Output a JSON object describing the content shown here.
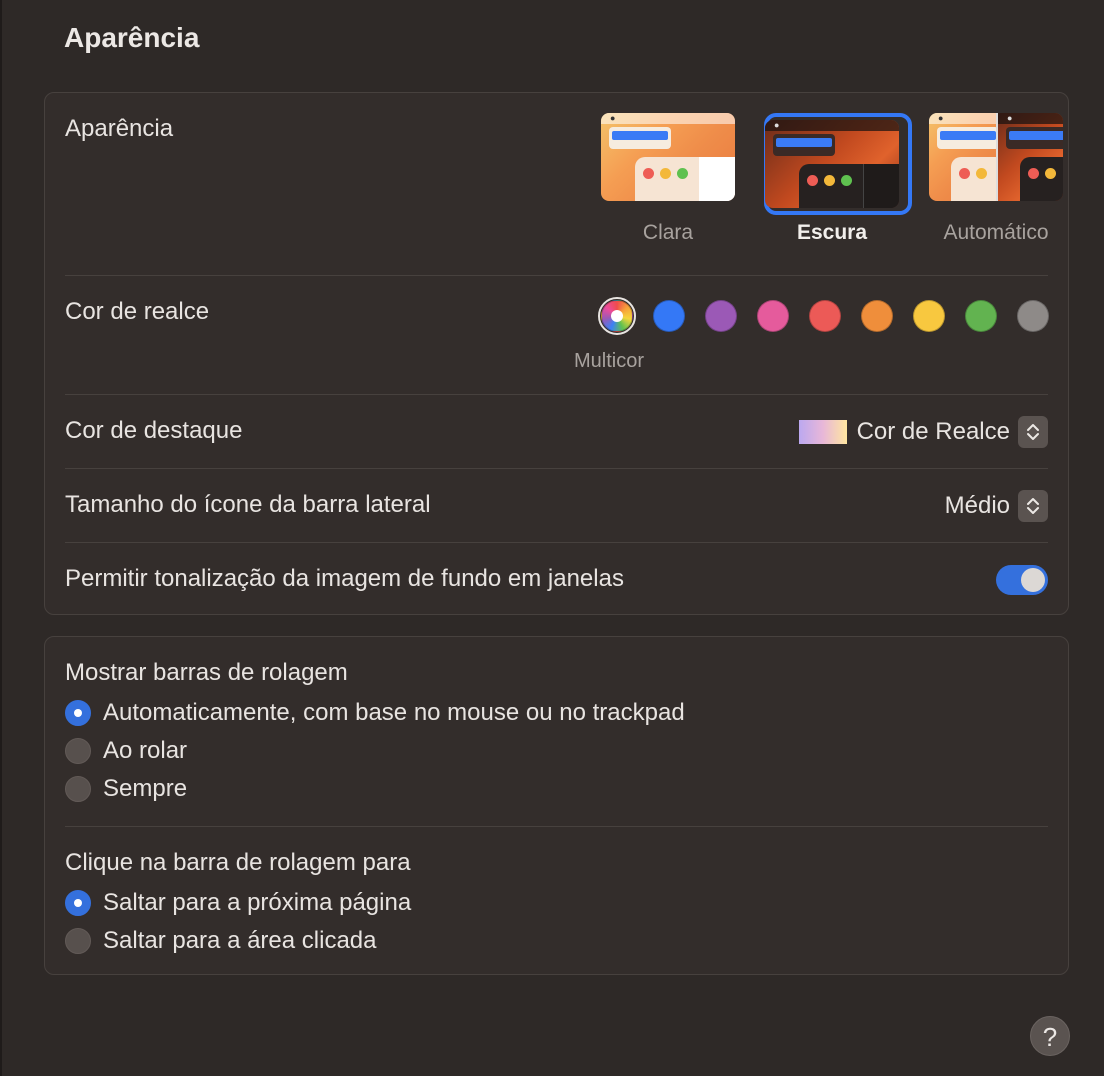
{
  "page": {
    "title": "Aparência"
  },
  "appearance": {
    "label": "Aparência",
    "options": [
      {
        "label": "Clara",
        "selected": false
      },
      {
        "label": "Escura",
        "selected": true
      },
      {
        "label": "Automático",
        "selected": false
      }
    ]
  },
  "accent": {
    "label": "Cor de realce",
    "selected_caption": "Multicor",
    "colors": [
      {
        "name": "multicolor",
        "color": "conic",
        "selected": true
      },
      {
        "name": "blue",
        "color": "#3478f6"
      },
      {
        "name": "purple",
        "color": "#9b59b6"
      },
      {
        "name": "pink",
        "color": "#e55b9c"
      },
      {
        "name": "red",
        "color": "#ec5a57"
      },
      {
        "name": "orange",
        "color": "#ef8e3b"
      },
      {
        "name": "yellow",
        "color": "#f8c83f"
      },
      {
        "name": "green",
        "color": "#62b350"
      },
      {
        "name": "graphite",
        "color": "#8e8a88"
      }
    ]
  },
  "highlight": {
    "label": "Cor de destaque",
    "value": "Cor de Realce"
  },
  "sidebar_icon_size": {
    "label": "Tamanho do ícone da barra lateral",
    "value": "Médio"
  },
  "wallpaper_tinting": {
    "label": "Permitir tonalização da imagem de fundo em janelas",
    "enabled": true
  },
  "show_scrollbars": {
    "title": "Mostrar barras de rolagem",
    "options": [
      {
        "label": "Automaticamente, com base no mouse ou no trackpad",
        "selected": true
      },
      {
        "label": "Ao rolar",
        "selected": false
      },
      {
        "label": "Sempre",
        "selected": false
      }
    ]
  },
  "click_scrollbar": {
    "title": "Clique na barra de rolagem para",
    "options": [
      {
        "label": "Saltar para a próxima página",
        "selected": true
      },
      {
        "label": "Saltar para a área clicada",
        "selected": false
      }
    ]
  },
  "help": {
    "label": "?"
  }
}
